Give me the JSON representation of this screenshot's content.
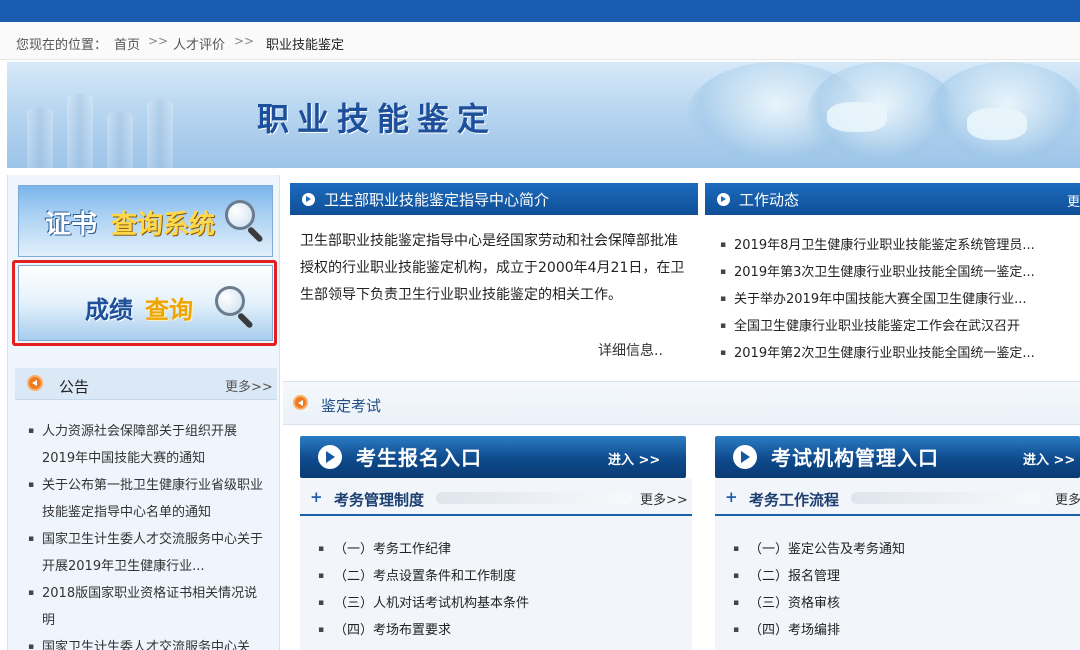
{
  "breadcrumb": {
    "prefix": "您现在的位置：",
    "items": [
      "首页",
      "人才评价",
      "职业技能鉴定"
    ],
    "separator": ">>"
  },
  "banner": {
    "title": "职业技能鉴定"
  },
  "sidebar": {
    "cert_button": {
      "part1": "证书",
      "part2": "查询系统"
    },
    "score_button": {
      "part1": "成绩",
      "part2": "查询"
    },
    "notice": {
      "title": "公告",
      "more": "更多>>",
      "items": [
        "人力资源社会保障部关于组织开展2019年中国技能大赛的通知",
        "关于公布第一批卫生健康行业省级职业技能鉴定指导中心名单的通知",
        "国家卫生计生委人才交流服务中心关于开展2019年卫生健康行业...",
        "2018版国家职业资格证书相关情况说明",
        "国家卫生计生委人才交流服务中心关"
      ]
    }
  },
  "intro": {
    "title": "卫生部职业技能鉴定指导中心简介",
    "text": "卫生部职业技能鉴定指导中心是经国家劳动和社会保障部批准授权的行业职业技能鉴定机构，成立于2000年4月21日，在卫生部领导下负责卫生行业职业技能鉴定的相关工作。",
    "detail": "详细信息.."
  },
  "news": {
    "title": "工作动态",
    "more": "更",
    "items": [
      "2019年8月卫生健康行业职业技能鉴定系统管理员...",
      "2019年第3次卫生健康行业职业技能全国统一鉴定...",
      "关于举办2019年中国技能大赛全国卫生健康行业...",
      "全国卫生健康行业职业技能鉴定工作会在武汉召开",
      "2019年第2次卫生健康行业职业技能全国统一鉴定..."
    ]
  },
  "exam": {
    "title": "鉴定考试",
    "candidate_entry": {
      "label": "考生报名入口",
      "enter": "进入 >>"
    },
    "org_entry": {
      "label": "考试机构管理入口",
      "enter": "进入 >>"
    },
    "rules": {
      "title": "考务管理制度",
      "more": "更多>>",
      "items": [
        "（一）考务工作纪律",
        "（二）考点设置条件和工作制度",
        "（三）人机对话考试机构基本条件",
        "（四）考场布置要求"
      ]
    },
    "process": {
      "title": "考务工作流程",
      "more": "更多",
      "items": [
        "（一）鉴定公告及考务通知",
        "（二）报名管理",
        "（三）资格审核",
        "（四）考场编排"
      ]
    }
  },
  "colors": {
    "nav_blue": "#1a5cb0",
    "section_blue": "#1c6bbd",
    "highlight_red": "#e32020",
    "accent_orange": "#f07a1d"
  }
}
